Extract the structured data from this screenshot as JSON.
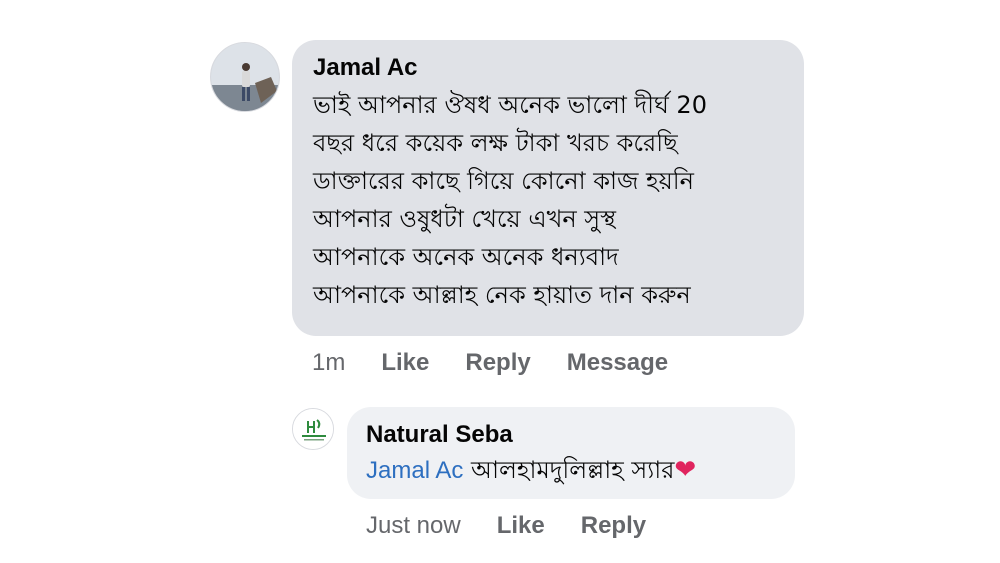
{
  "comments": [
    {
      "author": "Jamal Ac",
      "lines": [
        "ভাই আপনার ঔষধ   অনেক ভালো দীর্ঘ 20",
        "বছর ধরে কয়েক লক্ষ টাকা খরচ করেছি",
        "ডাক্তারের কাছে গিয়ে কোনো কাজ হয়নি",
        "আপনার ওষুধটা খেয়ে এখন সুস্থ",
        "আপনাকে অনেক অনেক ধন্যবাদ",
        "আপনাকে আল্লাহ নেক হায়াত দান করুন"
      ],
      "time": "1m",
      "actions": {
        "like": "Like",
        "reply": "Reply",
        "message": "Message"
      },
      "avatar_icon": "user-photo"
    }
  ],
  "reply": {
    "author": "Natural Seba",
    "mention": "Jamal Ac",
    "text": "আলহামদুলিল্লাহ স্যার",
    "emoji": "❤",
    "time": "Just now",
    "actions": {
      "like": "Like",
      "reply": "Reply"
    },
    "avatar": {
      "logo_text": "Natural Seba",
      "logo_color": "#2e8b3e"
    }
  },
  "colors": {
    "bubble": "#e4e6eb",
    "action_text": "#65676b",
    "mention": "#2d6fc0",
    "heart": "#e0245e"
  }
}
